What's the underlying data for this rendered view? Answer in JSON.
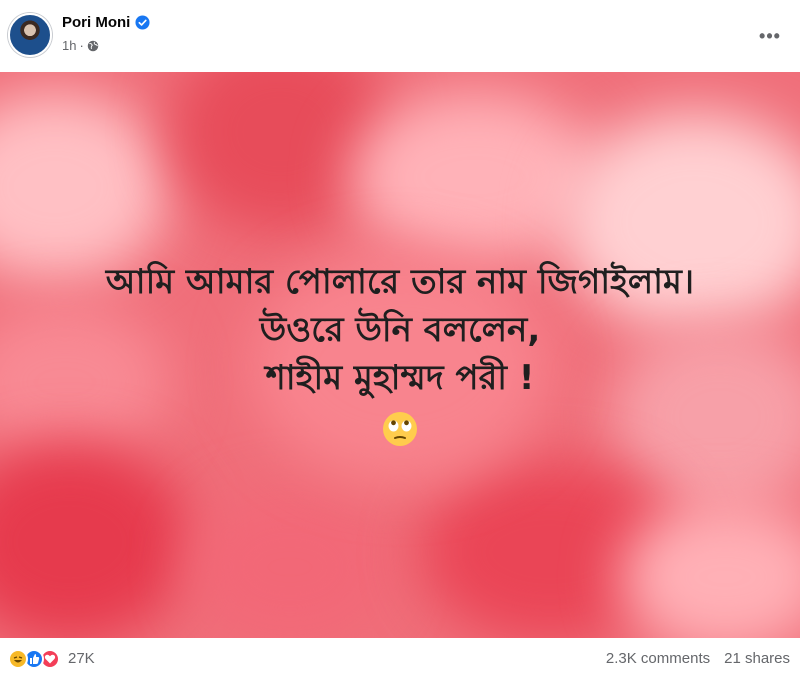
{
  "post": {
    "author": "Pori Moni",
    "time": "1h",
    "separator": "·",
    "more_label": "•••"
  },
  "icons": {
    "verified": "verified-badge-icon",
    "privacy": "globe-icon",
    "more": "more-options-icon",
    "emoji": "face-with-rolling-eyes-emoji",
    "reactions": [
      "haha-icon",
      "like-icon",
      "love-icon"
    ]
  },
  "content": {
    "lines": [
      "আমি আমার পোলারে তার নাম জিগাইলাম।",
      "উওরে উনি বললেন,",
      "শাহীম মুহাম্মদ পরী !"
    ]
  },
  "engagement": {
    "reaction_count": "27K",
    "comments": "2.3K comments",
    "shares": "21 shares"
  },
  "colors": {
    "verified": "#1877f2",
    "media_background": "#f06f7a",
    "meta_text": "#65676b"
  }
}
